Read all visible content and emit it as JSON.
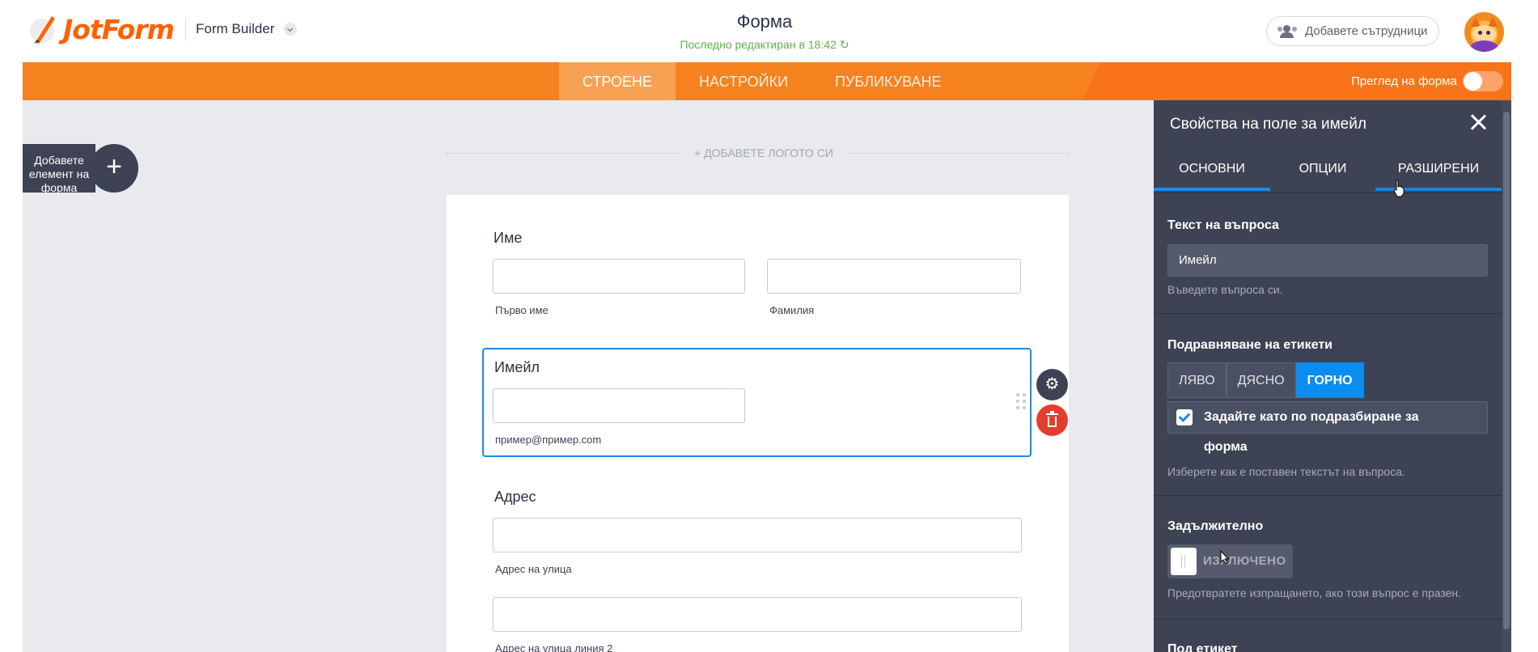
{
  "header": {
    "brand": "JotForm",
    "product": "Form Builder",
    "form_title": "Форма",
    "last_edited": "Последно редактиран в 18:42",
    "collaborators_button": "Добавете сътрудници"
  },
  "navbar": {
    "tabs": [
      {
        "label": "СТРОЕНЕ",
        "active": true
      },
      {
        "label": "НАСТРОЙКИ",
        "active": false
      },
      {
        "label": "ПУБЛИКУВАНЕ",
        "active": false
      }
    ],
    "preview_label": "Преглед на форма",
    "preview_enabled": false,
    "accent_color": "#f5821f"
  },
  "canvas": {
    "add_element_label": "Добавете елемент на форма",
    "add_logo": "+ ДОБАВЕТЕ ЛОГОТО СИ"
  },
  "form": {
    "name_field": {
      "label": "Име",
      "first_sublabel": "Първо име",
      "last_sublabel": "Фамилия"
    },
    "email_field": {
      "label": "Имейл",
      "sublabel": "пример@пример.com",
      "selected": true
    },
    "address_field": {
      "label": "Адрес",
      "street_sublabel": "Адрес на улица",
      "street2_sublabel": "Адрес на улица линия 2"
    }
  },
  "panel": {
    "title": "Свойства на поле за имейл",
    "tabs": [
      {
        "label": "ОСНОВНИ",
        "active": true
      },
      {
        "label": "ОПЦИИ",
        "active": false
      },
      {
        "label": "РАЗШИРЕНИ",
        "active": false
      }
    ],
    "question_text": {
      "title": "Текст на въпроса",
      "value": "Имейл",
      "help": "Въведете въпроса си."
    },
    "label_alignment": {
      "title": "Подравняване на етикети",
      "options": [
        "ЛЯВО",
        "ДЯСНО",
        "ГОРНО"
      ],
      "selected": "ГОРНО",
      "default_checkbox": "Задайте като по подразбиране за форма",
      "default_checked": true,
      "help": "Изберете как е поставен текстът на въпроса."
    },
    "required": {
      "title": "Задължително",
      "state": "ИЗКЛЮЧЕНО",
      "help": "Предотвратете изпращането, ако този въпрос е празен."
    },
    "sublabel_title": "Под етикет"
  },
  "icons": {
    "gear": "gear-icon",
    "trash": "trash-icon",
    "close": "close-icon",
    "plus": "plus-icon",
    "refresh": "refresh-icon",
    "collaborators": "users-icon"
  }
}
